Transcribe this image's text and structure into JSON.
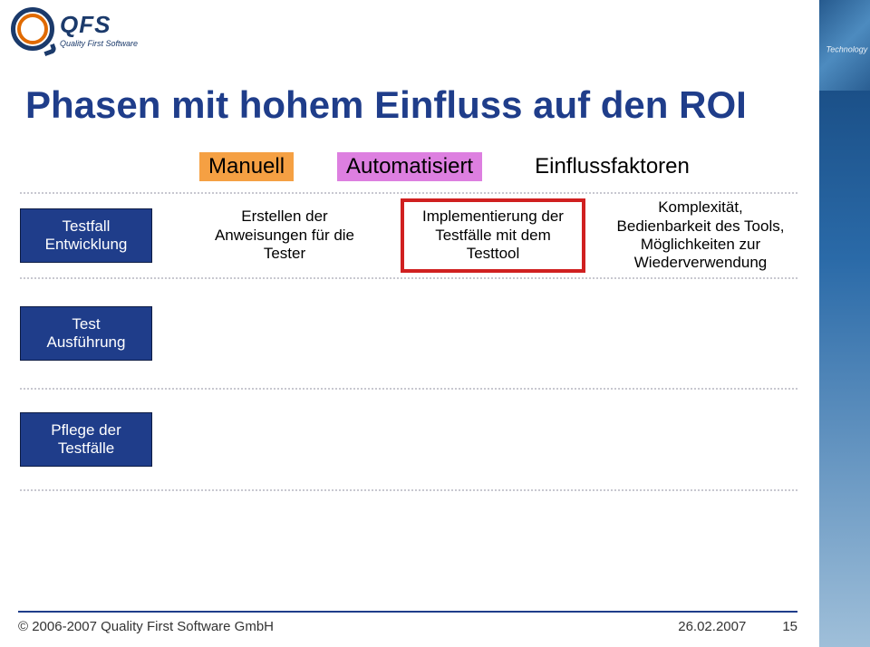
{
  "logo": {
    "big": "QFS",
    "small": "Quality First Software"
  },
  "title": "Phasen mit hohem Einfluss auf den ROI",
  "columns": {
    "manual": "Manuell",
    "auto": "Automatisiert",
    "factors": "Einflussfaktoren"
  },
  "row1": {
    "phase_l1": "Testfall",
    "phase_l2": "Entwicklung",
    "manual": "Erstellen der Anweisungen für die Tester",
    "auto": "Implementierung der Testfälle mit dem Testtool",
    "factors": "Komplexität, Bedienbarkeit des Tools, Möglichkeiten zur Wiederverwendung"
  },
  "row2": {
    "phase_l1": "Test",
    "phase_l2": "Ausführung"
  },
  "row3": {
    "phase_l1": "Pflege der",
    "phase_l2": "Testfälle"
  },
  "footer": {
    "copyright": "© 2006-2007 Quality First Software GmbH",
    "date": "26.02.2007",
    "page": "15"
  }
}
